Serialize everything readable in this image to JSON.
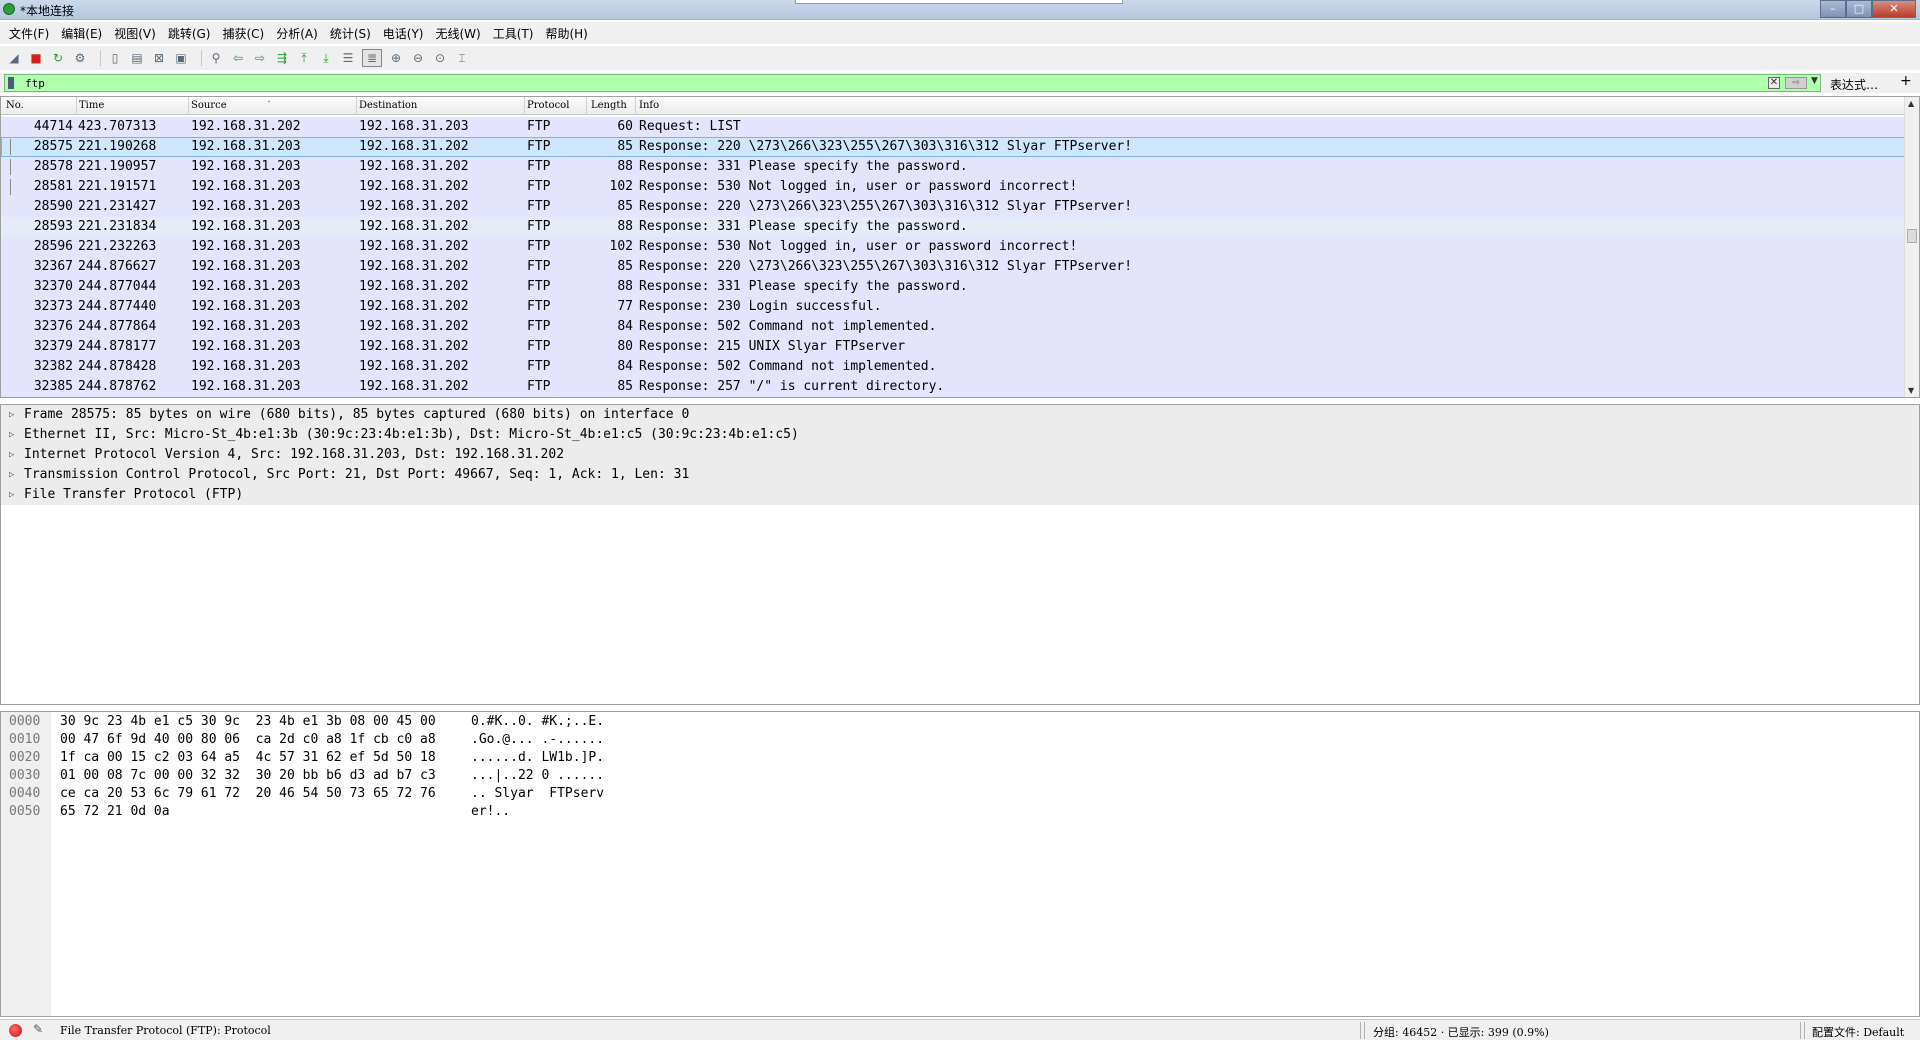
{
  "window": {
    "title": "*本地连接"
  },
  "menu": [
    "文件(F)",
    "编辑(E)",
    "视图(V)",
    "跳转(G)",
    "捕获(C)",
    "分析(A)",
    "统计(S)",
    "电话(Y)",
    "无线(W)",
    "工具(T)",
    "帮助(H)"
  ],
  "filter": {
    "value": "ftp",
    "expression_label": "表达式…",
    "add_label": "+"
  },
  "packet_list": {
    "columns": [
      "No.",
      "Time",
      "Source",
      "Destination",
      "Protocol",
      "Length",
      "Info"
    ],
    "rows": [
      {
        "no": "44714",
        "time": "423.707313",
        "source": "192.168.31.202",
        "destination": "192.168.31.203",
        "protocol": "FTP",
        "length": "60",
        "info": "Request: LIST"
      },
      {
        "no": "28575",
        "time": "221.190268",
        "source": "192.168.31.203",
        "destination": "192.168.31.202",
        "protocol": "FTP",
        "length": "85",
        "info": "Response: 220 \\273\\266\\323\\255\\267\\303\\316\\312 Slyar FTPserver!"
      },
      {
        "no": "28578",
        "time": "221.190957",
        "source": "192.168.31.203",
        "destination": "192.168.31.202",
        "protocol": "FTP",
        "length": "88",
        "info": "Response: 331 Please specify the password."
      },
      {
        "no": "28581",
        "time": "221.191571",
        "source": "192.168.31.203",
        "destination": "192.168.31.202",
        "protocol": "FTP",
        "length": "102",
        "info": "Response: 530 Not logged in, user or password incorrect!"
      },
      {
        "no": "28590",
        "time": "221.231427",
        "source": "192.168.31.203",
        "destination": "192.168.31.202",
        "protocol": "FTP",
        "length": "85",
        "info": "Response: 220 \\273\\266\\323\\255\\267\\303\\316\\312 Slyar FTPserver!"
      },
      {
        "no": "28593",
        "time": "221.231834",
        "source": "192.168.31.203",
        "destination": "192.168.31.202",
        "protocol": "FTP",
        "length": "88",
        "info": "Response: 331 Please specify the password."
      },
      {
        "no": "28596",
        "time": "221.232263",
        "source": "192.168.31.203",
        "destination": "192.168.31.202",
        "protocol": "FTP",
        "length": "102",
        "info": "Response: 530 Not logged in, user or password incorrect!"
      },
      {
        "no": "32367",
        "time": "244.876627",
        "source": "192.168.31.203",
        "destination": "192.168.31.202",
        "protocol": "FTP",
        "length": "85",
        "info": "Response: 220 \\273\\266\\323\\255\\267\\303\\316\\312 Slyar FTPserver!"
      },
      {
        "no": "32370",
        "time": "244.877044",
        "source": "192.168.31.203",
        "destination": "192.168.31.202",
        "protocol": "FTP",
        "length": "88",
        "info": "Response: 331 Please specify the password."
      },
      {
        "no": "32373",
        "time": "244.877440",
        "source": "192.168.31.203",
        "destination": "192.168.31.202",
        "protocol": "FTP",
        "length": "77",
        "info": "Response: 230 Login successful."
      },
      {
        "no": "32376",
        "time": "244.877864",
        "source": "192.168.31.203",
        "destination": "192.168.31.202",
        "protocol": "FTP",
        "length": "84",
        "info": "Response: 502 Command not implemented."
      },
      {
        "no": "32379",
        "time": "244.878177",
        "source": "192.168.31.203",
        "destination": "192.168.31.202",
        "protocol": "FTP",
        "length": "80",
        "info": "Response: 215 UNIX Slyar FTPserver"
      },
      {
        "no": "32382",
        "time": "244.878428",
        "source": "192.168.31.203",
        "destination": "192.168.31.202",
        "protocol": "FTP",
        "length": "84",
        "info": "Response: 502 Command not implemented."
      },
      {
        "no": "32385",
        "time": "244.878762",
        "source": "192.168.31.203",
        "destination": "192.168.31.202",
        "protocol": "FTP",
        "length": "85",
        "info": "Response: 257 \"/\" is current directory."
      }
    ]
  },
  "details": [
    "Frame 28575: 85 bytes on wire (680 bits), 85 bytes captured (680 bits) on interface 0",
    "Ethernet II, Src: Micro-St_4b:e1:3b (30:9c:23:4b:e1:3b), Dst: Micro-St_4b:e1:c5 (30:9c:23:4b:e1:c5)",
    "Internet Protocol Version 4, Src: 192.168.31.203, Dst: 192.168.31.202",
    "Transmission Control Protocol, Src Port: 21, Dst Port: 49667, Seq: 1, Ack: 1, Len: 31",
    "File Transfer Protocol (FTP)"
  ],
  "bytes": [
    {
      "offset": "0000",
      "hex": "30 9c 23 4b e1 c5 30 9c  23 4b e1 3b 08 00 45 00",
      "ascii": "0.#K..0. #K.;..E."
    },
    {
      "offset": "0010",
      "hex": "00 47 6f 9d 40 00 80 06  ca 2d c0 a8 1f cb c0 a8",
      "ascii": ".Go.@... .-......"
    },
    {
      "offset": "0020",
      "hex": "1f ca 00 15 c2 03 64 a5  4c 57 31 62 ef 5d 50 18",
      "ascii": "......d. LW1b.]P."
    },
    {
      "offset": "0030",
      "hex": "01 00 08 7c 00 00 32 32  30 20 bb b6 d3 ad b7 c3",
      "ascii": "...|..22 0 ......"
    },
    {
      "offset": "0040",
      "hex": "ce ca 20 53 6c 79 61 72  20 46 54 50 73 65 72 76",
      "ascii": ".. Slyar  FTPserv"
    },
    {
      "offset": "0050",
      "hex": "65 72 21 0d 0a",
      "ascii": "er!.."
    }
  ],
  "status": {
    "field_info": "File Transfer Protocol (FTP): Protocol",
    "packets": "分组: 46452 · 已显示: 399 (0.9%)",
    "profile": "配置文件: Default"
  },
  "colors": {
    "row_bg": "#e4e4ff",
    "selected_row": "#cfe6ff",
    "filter_ok": "#afffaf",
    "detail_bg": "#ececec"
  }
}
